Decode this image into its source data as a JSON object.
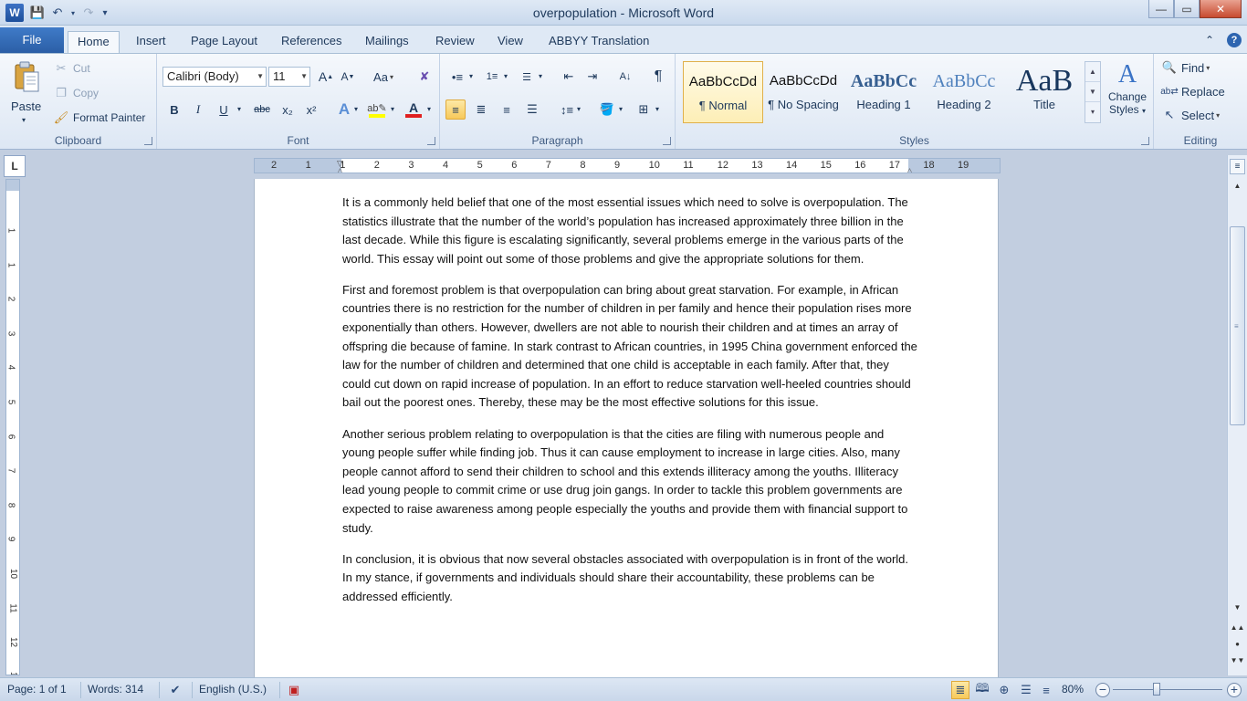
{
  "window": {
    "title": "overpopulation  -  Microsoft Word",
    "app_icon": "W",
    "controls": {
      "minimize": "—",
      "maximize": "▭",
      "close": "✕"
    }
  },
  "quick_access": {
    "save": "save-icon",
    "undo": "undo-icon",
    "redo": "redo-icon",
    "customize": "▾"
  },
  "tabs": [
    {
      "label": "File"
    },
    {
      "label": "Home"
    },
    {
      "label": "Insert"
    },
    {
      "label": "Page Layout"
    },
    {
      "label": "References"
    },
    {
      "label": "Mailings"
    },
    {
      "label": "Review"
    },
    {
      "label": "View"
    },
    {
      "label": "ABBYY Translation"
    }
  ],
  "active_tab": "Home",
  "ribbon": {
    "clipboard": {
      "label": "Clipboard",
      "paste": "Paste",
      "cut": "Cut",
      "copy": "Copy",
      "format_painter": "Format Painter"
    },
    "font": {
      "label": "Font",
      "font_name": "Calibri (Body)",
      "font_size": "11",
      "bold": "B",
      "italic": "I",
      "underline": "U",
      "strikethrough": "abc",
      "subscript": "x₂",
      "superscript": "x²",
      "grow": "A",
      "shrink": "A",
      "change_case": "Aa",
      "text_effects": "A",
      "font_color_letter": "A"
    },
    "paragraph": {
      "label": "Paragraph",
      "pilcrow": "¶"
    },
    "styles": {
      "label": "Styles",
      "items": [
        {
          "sample": "AaBbCcDd",
          "name": "¶ Normal"
        },
        {
          "sample": "AaBbCcDd",
          "name": "¶ No Spacing"
        },
        {
          "sample": "AaBbCc",
          "name": "Heading 1"
        },
        {
          "sample": "AaBbCc",
          "name": "Heading 2"
        },
        {
          "sample": "AaB",
          "name": "Title"
        }
      ],
      "change_styles_line1": "Change",
      "change_styles_line2": "Styles"
    },
    "editing": {
      "label": "Editing",
      "find": "Find",
      "replace": "Replace",
      "select": "Select"
    }
  },
  "ruler": {
    "horizontal": [
      "2",
      "1",
      "1",
      "2",
      "3",
      "4",
      "5",
      "6",
      "7",
      "8",
      "9",
      "10",
      "11",
      "12",
      "13",
      "14",
      "15",
      "16",
      "17",
      "18",
      "19"
    ],
    "vertical": [
      "1",
      "1",
      "2",
      "3",
      "4",
      "5",
      "6",
      "7",
      "8",
      "9",
      "10",
      "11",
      "12",
      "13"
    ],
    "corner": "L"
  },
  "document": {
    "paragraphs": [
      "It is a commonly held belief that one of the most essential issues which need to solve is overpopulation. The statistics illustrate that the number of the world’s population has increased approximately three billion in the last decade. While this figure is escalating significantly, several problems emerge in the various parts of the world. This essay will point out some of those problems and give the appropriate solutions for them.",
      "First and foremost problem is that overpopulation can bring about great starvation. For example, in African countries there is no restriction for the number of children in per family and hence their population rises more exponentially than others. However, dwellers are not able to nourish their children and at times an array of offspring die because of famine. In stark contrast to African countries, in 1995  China government enforced the law for the number of children and determined that one child is acceptable in each family. After that, they could cut down on rapid increase of population. In an effort to reduce starvation well-heeled countries should bail out the poorest ones. Thereby, these may be the most effective solutions for this issue.",
      "Another serious problem relating to overpopulation is that the cities are filing with numerous people and young people suffer while finding job. Thus it can cause employment to increase in large cities. Also, many people cannot afford to send their children to school and this extends illiteracy among the youths. Illiteracy lead young people to commit crime  or use drug join gangs. In order to tackle this problem governments are expected to raise awareness among people especially the youths and provide them with financial support to study.",
      "In conclusion, it is obvious that now several obstacles associated with overpopulation is in front of the world. In my stance, if governments and individuals should share their accountability, these problems can be addressed efficiently."
    ]
  },
  "statusbar": {
    "page": "Page: 1 of 1",
    "words": "Words: 314",
    "language": "English (U.S.)",
    "zoom": "80%",
    "zoom_level": 0.8
  },
  "colors": {
    "file_tab": "#2b5ea6",
    "selected_highlight": "#f7c95a",
    "heading_blue": "#365f91",
    "heading2_blue": "#4f81bd",
    "title_navy": "#17365d",
    "font_color_red": "#e02020",
    "highlight_yellow": "#ffff00"
  }
}
